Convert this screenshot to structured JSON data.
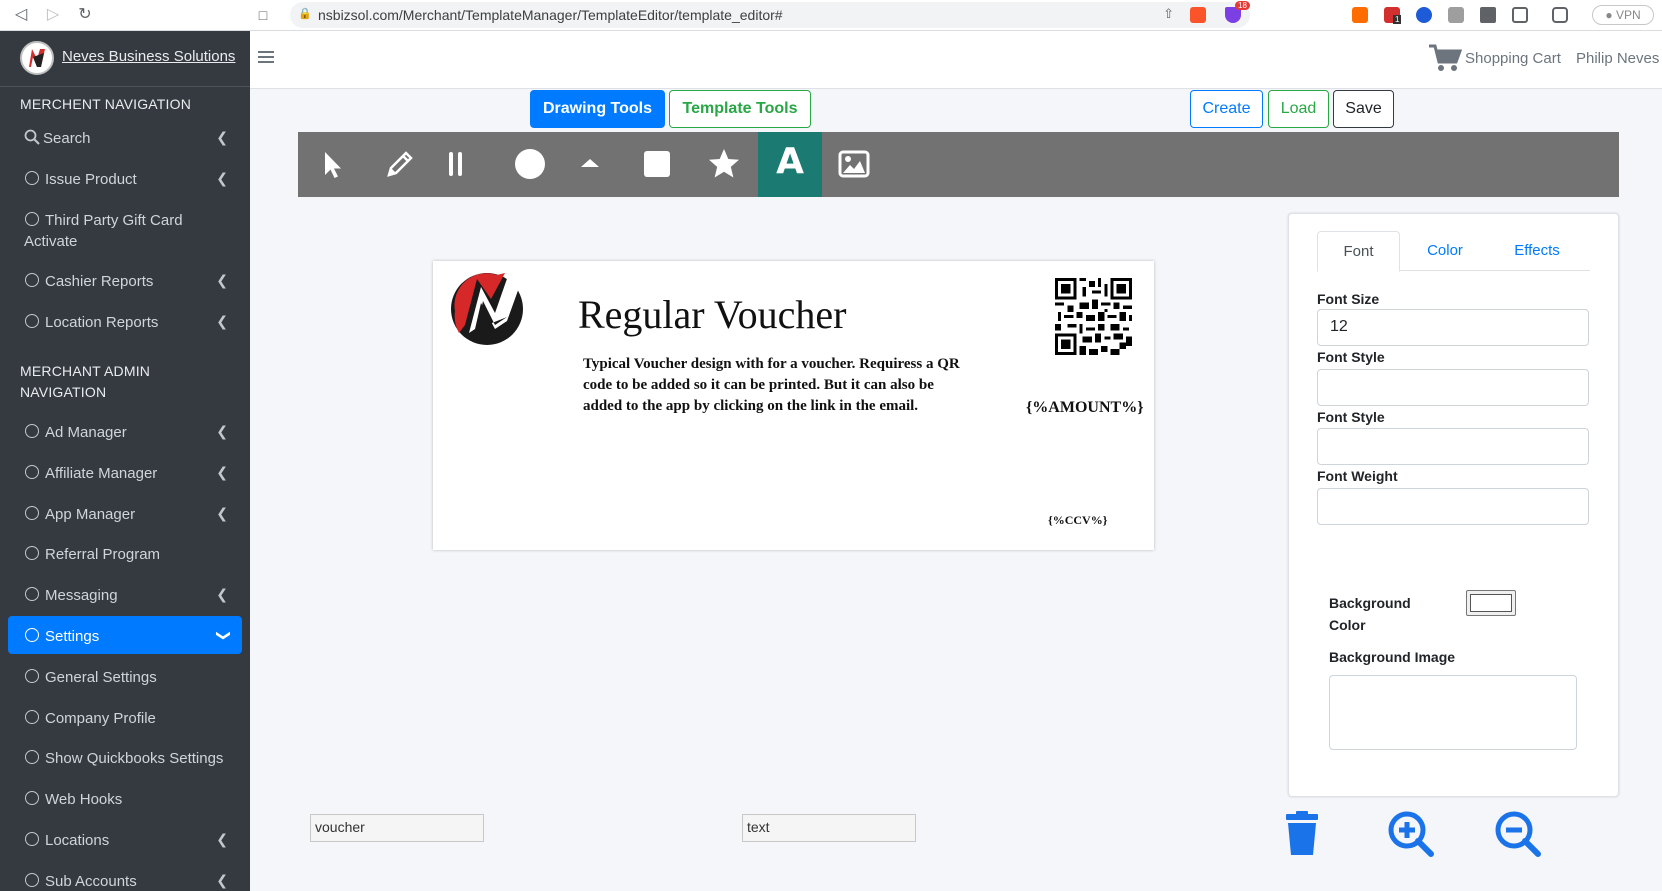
{
  "browser": {
    "url": "nsbizsol.com/Merchant/TemplateManager/TemplateEditor/template_editor#",
    "vpn_label": "VPN",
    "shield_badge": "18",
    "ext_badge": "1"
  },
  "sidebar": {
    "brand": "Neves Business Solutions",
    "merchant_header": "MERCHENT NAVIGATION",
    "admin_header": "MERCHANT ADMIN NAVIGATION",
    "merchant_items": [
      {
        "label": "Search",
        "icon": "search-icon",
        "chevron": true
      },
      {
        "label": "Issue Product",
        "icon": "circle-icon",
        "chevron": true
      },
      {
        "label": "Third Party Gift Card Activate",
        "icon": "circle-icon",
        "chevron": false
      },
      {
        "label": "Cashier Reports",
        "icon": "circle-icon",
        "chevron": true
      },
      {
        "label": "Location Reports",
        "icon": "circle-icon",
        "chevron": true
      }
    ],
    "admin_items": [
      {
        "label": "Ad Manager",
        "chevron": true
      },
      {
        "label": "Affiliate Manager",
        "chevron": true
      },
      {
        "label": "App Manager",
        "chevron": true
      },
      {
        "label": "Referral Program",
        "chevron": false
      },
      {
        "label": "Messaging",
        "chevron": true
      },
      {
        "label": "Settings",
        "chevron": true,
        "active": true
      },
      {
        "label": "General Settings",
        "chevron": false
      },
      {
        "label": "Company Profile",
        "chevron": false
      },
      {
        "label": "Show Quickbooks Settings",
        "chevron": false
      },
      {
        "label": "Web Hooks",
        "chevron": false
      },
      {
        "label": "Locations",
        "chevron": true
      },
      {
        "label": "Sub Accounts",
        "chevron": true
      }
    ]
  },
  "topbar": {
    "cart_label": "Shopping Cart",
    "user_name": "Philip Neves"
  },
  "buttons": {
    "drawing_tools": "Drawing Tools",
    "template_tools": "Template Tools",
    "create": "Create",
    "load": "Load",
    "save": "Save"
  },
  "toolbar": {
    "tools": [
      "select-pointer-icon",
      "pencil-icon",
      "line-icon",
      "circle-icon",
      "triangle-icon",
      "rectangle-icon",
      "star-icon",
      "text-icon",
      "image-icon"
    ],
    "text_tool_glyph": "A",
    "active_tool": "text-icon"
  },
  "canvas": {
    "title": "Regular Voucher",
    "description": "Typical Voucher design with for a voucher. Requiress a QR code to be added so it can be printed. But it can also be added to the app by clicking on the link in the email.",
    "amount_token": "{%AMOUNT%}",
    "ccv_token": "{%CCV%}"
  },
  "properties": {
    "tabs": {
      "font": "Font",
      "color": "Color",
      "effects": "Effects"
    },
    "active_tab": "Font",
    "font_size_label": "Font Size",
    "font_size_value": "12",
    "font_style_label_1": "Font Style",
    "font_style_value_1": "",
    "font_style_label_2": "Font Style",
    "font_style_value_2": "",
    "font_weight_label": "Font Weight",
    "font_weight_value": "",
    "background_color_label": "Background Color",
    "background_color_value": "#ffffff",
    "background_image_label": "Background Image"
  },
  "bottom": {
    "object_name_value": "voucher",
    "object_type_value": "text",
    "actions": [
      "trash-icon",
      "zoom-in-icon",
      "zoom-out-icon"
    ]
  },
  "colors": {
    "sidebar_bg": "#343a40",
    "primary": "#007bff",
    "success": "#28a745",
    "toolbar_bg": "#727272",
    "active_tool_bg": "#1b7b73",
    "action_icon": "#1a73e8"
  }
}
